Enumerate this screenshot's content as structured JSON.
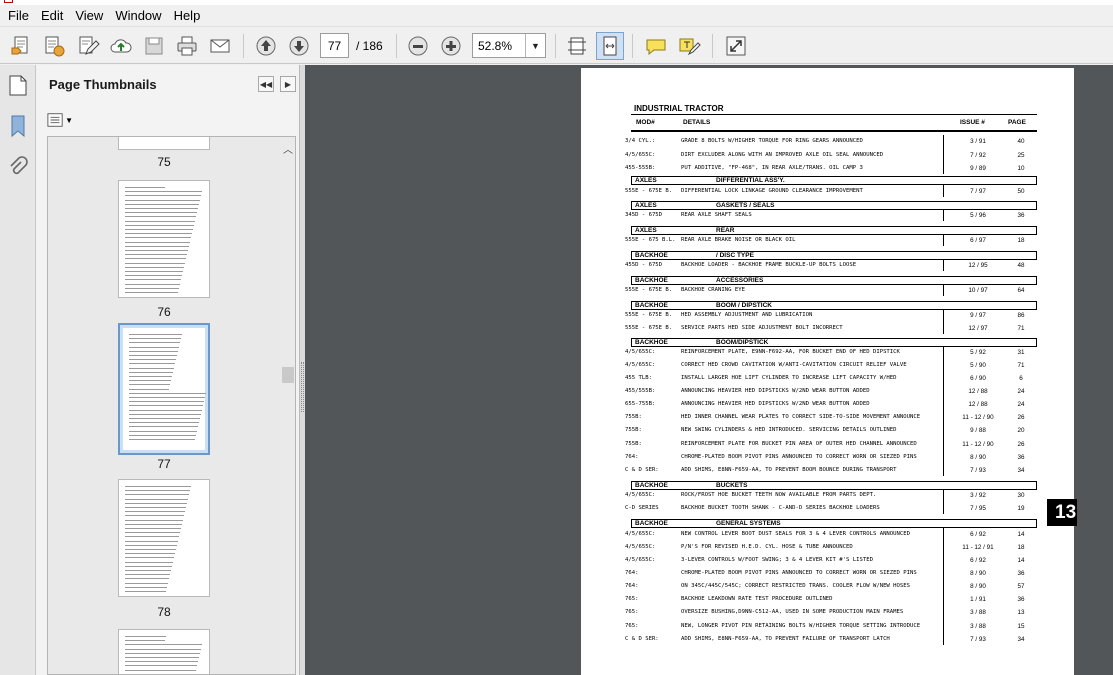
{
  "menu": [
    "File",
    "Edit",
    "View",
    "Window",
    "Help"
  ],
  "toolbar": {
    "current_page": "77",
    "total_pages": "/ 186",
    "zoom": "52.8%"
  },
  "panel": {
    "title": "Page Thumbnails",
    "thumbnails": [
      {
        "label": "75"
      },
      {
        "label": "76"
      },
      {
        "label": "77",
        "selected": true
      },
      {
        "label": "78"
      }
    ]
  },
  "document": {
    "title": "INDUSTRIAL TRACTOR",
    "columns": {
      "mod": "MOD#",
      "details": "DETAILS",
      "issue": "ISSUE #",
      "page": "PAGE"
    },
    "tab_marker": "13",
    "rows": [
      {
        "kind": "row",
        "mod": "3/4 CYL.:",
        "details": "GRADE 8 BOLTS W/HIGHER TORQUE FOR RING GEARS ANNOUNCED",
        "issue": "3 / 91",
        "page": "40"
      },
      {
        "kind": "row",
        "mod": "4/5/655C:",
        "details": "DIRT EXCLUDER ALONG WITH AN IMPROVED AXLE OIL SEAL ANNOUNCED",
        "issue": "7 / 92",
        "page": "25"
      },
      {
        "kind": "row",
        "mod": "455-555B:",
        "details": "PUT ADDITIVE, \"FP-468\", IN REAR AXLE/TRANS. OIL               CAMP 3",
        "issue": "9 / 89",
        "page": "10"
      },
      {
        "kind": "sect",
        "a": "AXLES",
        "b": "DIFFERENTIAL ASS'Y."
      },
      {
        "kind": "row",
        "mod": "555E - 675E B.",
        "details": "DIFFERENTIAL LOCK LINKAGE GROUND CLEARANCE IMPROVEMENT",
        "issue": "7 / 97",
        "page": "50"
      },
      {
        "kind": "sect",
        "a": "AXLES",
        "b": "GASKETS / SEALS"
      },
      {
        "kind": "row",
        "mod": "345D - 675D",
        "details": "REAR AXLE SHAFT SEALS",
        "issue": "5 / 96",
        "page": "36"
      },
      {
        "kind": "sect",
        "a": "AXLES",
        "b": "REAR"
      },
      {
        "kind": "row",
        "mod": "555E - 675 B.L.",
        "details": "REAR AXLE BRAKE NOISE OR BLACK OIL",
        "issue": "6 / 97",
        "page": "18"
      },
      {
        "kind": "sect",
        "a": "BACKHOE",
        "b": "/ DISC TYPE"
      },
      {
        "kind": "row",
        "mod": "455D - 675D",
        "details": "BACKHOE LOADER - BACKHOE FRAME BUCKLE-UP BOLTS LOOSE",
        "issue": "12 / 95",
        "page": "48"
      },
      {
        "kind": "sect",
        "a": "BACKHOE",
        "b": "ACCESSORIES"
      },
      {
        "kind": "row",
        "mod": "555E - 675E B.",
        "details": "BACKHOE CRANING EYE",
        "issue": "10 / 97",
        "page": "64"
      },
      {
        "kind": "sect",
        "a": "BACKHOE",
        "b": "BOOM / DIPSTICK"
      },
      {
        "kind": "row",
        "mod": "555E - 675E B.",
        "details": "HED ASSEMBLY ADJUSTMENT AND LUBRICATION",
        "issue": "9 / 97",
        "page": "86"
      },
      {
        "kind": "row",
        "mod": "555E - 675E B.",
        "details": "SERVICE PARTS HED SIDE ADJUSTMENT BOLT INCORRECT",
        "issue": "12 / 97",
        "page": "71"
      },
      {
        "kind": "sect",
        "a": "BACKHOE",
        "b": "BOOM/DIPSTICK"
      },
      {
        "kind": "row",
        "mod": "4/5/655C:",
        "details": "REINFORCEMENT PLATE, E9NN-F692-AA, FOR BUCKET END OF HED DIPSTICK",
        "issue": "5 / 92",
        "page": "31"
      },
      {
        "kind": "row",
        "mod": "4/5/655C:",
        "details": "CORRECT HED CROWD CAVITATION W/ANTI-CAVITATION CIRCUIT RELIEF VALVE",
        "issue": "5 / 90",
        "page": "71"
      },
      {
        "kind": "row",
        "mod": "455 TLB:",
        "details": "INSTALL LARGER HOE LIFT CYLINDER TO INCREASE LIFT CAPACITY W/HED",
        "issue": "6 / 90",
        "page": "6"
      },
      {
        "kind": "row",
        "mod": "455/555B:",
        "details": "ANNOUNCING HEAVIER HED DIPSTICKS W/2ND WEAR BUTTON ADDED",
        "issue": "12 / 88",
        "page": "24"
      },
      {
        "kind": "row",
        "mod": "655-755B:",
        "details": "ANNOUNCING HEAVIER HED DIPSTICKS W/2ND WEAR BUTTON ADDED",
        "issue": "12 / 88",
        "page": "24"
      },
      {
        "kind": "row",
        "mod": "755B:",
        "details": "HED INNER CHANNEL WEAR PLATES TO CORRECT SIDE-TO-SIDE MOVEMENT ANNOUNCE",
        "issue": "11 - 12 / 90",
        "page": "26"
      },
      {
        "kind": "row",
        "mod": "755B:",
        "details": "NEW SWING CYLINDERS & HED INTRODUCED. SERVICING DETAILS OUTLINED",
        "issue": "9 / 88",
        "page": "20"
      },
      {
        "kind": "row",
        "mod": "755B:",
        "details": "REINFORCEMENT PLATE FOR BUCKET PIN AREA OF OUTER HED CHANNEL ANNOUNCED",
        "issue": "11 - 12 / 90",
        "page": "26"
      },
      {
        "kind": "row",
        "mod": "764:",
        "details": "CHROME-PLATED BOOM PIVOT PINS ANNOUNCED TO CORRECT WORN OR SIEZED PINS",
        "issue": "8 / 90",
        "page": "36"
      },
      {
        "kind": "row",
        "mod": "C & D SER:",
        "details": "ADD SHIMS, E8NN-F659-AA, TO PREVENT BOOM BOUNCE DURING TRANSPORT",
        "issue": "7 / 93",
        "page": "34"
      },
      {
        "kind": "sect",
        "a": "BACKHOE",
        "b": "BUCKETS"
      },
      {
        "kind": "row",
        "mod": "4/5/655C:",
        "details": "ROCK/FROST HOE BUCKET TEETH NOW AVAILABLE FROM PARTS DEPT.",
        "issue": "3 / 92",
        "page": "30"
      },
      {
        "kind": "row",
        "mod": "C-D SERIES",
        "details": "BACKHOE BUCKET TOOTH SHANK - C-AND-D SERIES BACKHOE LOADERS",
        "issue": "7 / 95",
        "page": "19"
      },
      {
        "kind": "sect",
        "a": "BACKHOE",
        "b": "GENERAL SYSTEMS"
      },
      {
        "kind": "row",
        "mod": "4/5/655C:",
        "details": "NEW CONTROL LEVER BOOT DUST SEALS FOR 3 & 4 LEVER CONTROLS ANNOUNCED",
        "issue": "6 / 92",
        "page": "14"
      },
      {
        "kind": "row",
        "mod": "4/5/655C:",
        "details": "P/N'S FOR REVISED H.E.D. CYL. HOSE & TUBE ANNOUNCED",
        "issue": "11 - 12 / 91",
        "page": "18"
      },
      {
        "kind": "row",
        "mod": "4/5/655C:",
        "details": "3-LEVER CONTROLS W/FOOT SWING; 3 & 4 LEVER KIT #'S LISTED",
        "issue": "6 / 92",
        "page": "14"
      },
      {
        "kind": "row",
        "mod": "764:",
        "details": "CHROME-PLATED BOOM PIVOT PINS ANNOUNCED TO CORRECT WORN OR SIEZED PINS",
        "issue": "8 / 90",
        "page": "36"
      },
      {
        "kind": "row",
        "mod": "764:",
        "details": "ON 345C/445C/545C; CORRECT RESTRICTED TRANS. COOLER FLOW W/NEW HOSES",
        "issue": "8 / 90",
        "page": "57"
      },
      {
        "kind": "row",
        "mod": "765:",
        "details": "BACKHOE LEAKDOWN RATE TEST PROCEDURE OUTLINED",
        "issue": "1 / 91",
        "page": "36"
      },
      {
        "kind": "row",
        "mod": "765:",
        "details": "OVERSIZE BUSHING,D9NN-C512-AA, USED IN SOME PRODUCTION MAIN FRAMES",
        "issue": "3 / 88",
        "page": "13"
      },
      {
        "kind": "row",
        "mod": "765:",
        "details": "NEW, LONGER PIVOT PIN RETAINING BOLTS W/HIGHER TORQUE SETTING INTRODUCE",
        "issue": "3 / 88",
        "page": "15"
      },
      {
        "kind": "row",
        "mod": "C & D SER:",
        "details": "ADD SHIMS, E8NN-F659-AA, TO PREVENT FAILURE OF TRANSPORT LATCH",
        "issue": "7 / 93",
        "page": "34"
      }
    ]
  }
}
